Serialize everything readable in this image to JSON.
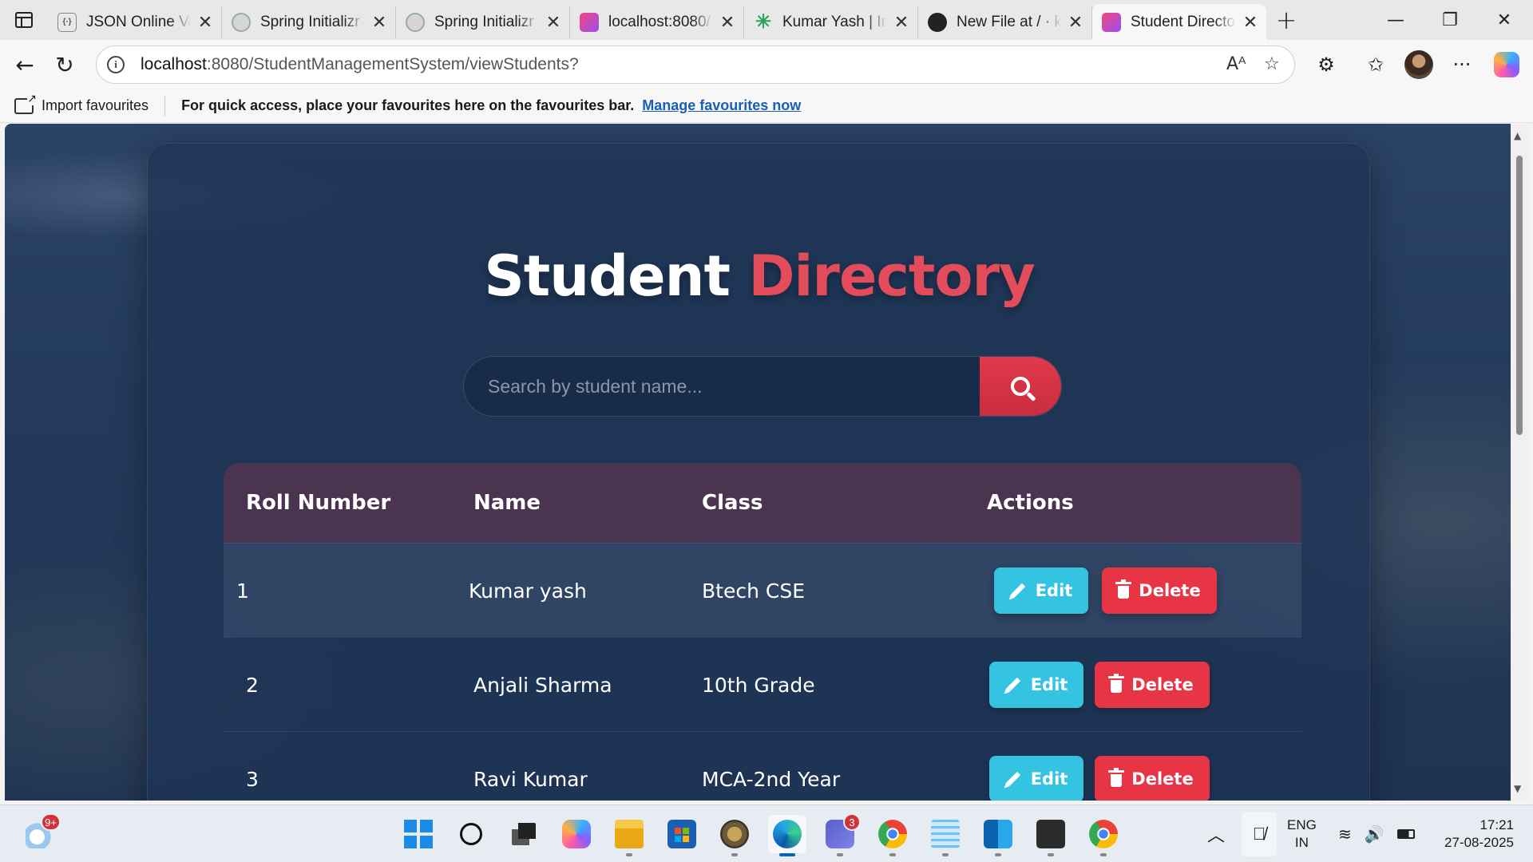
{
  "browser": {
    "tabs": [
      {
        "title": "JSON Online Va",
        "icon": "json-icon",
        "active": false
      },
      {
        "title": "Spring Initializr",
        "icon": "spring-icon",
        "active": false
      },
      {
        "title": "Spring Initializr",
        "icon": "spring-icon",
        "active": false
      },
      {
        "title": "localhost:8080/",
        "icon": "page-icon",
        "active": false
      },
      {
        "title": "Kumar Yash | Ins",
        "icon": "asterisk-icon",
        "active": false
      },
      {
        "title": "New File at / · k",
        "icon": "github-icon",
        "active": false
      },
      {
        "title": "Student Directo",
        "icon": "page-icon",
        "active": true
      }
    ],
    "url_host": "localhost",
    "url_rest": ":8080/StudentManagementSystem/viewStudents?",
    "favourites_bar": {
      "import_label": "Import favourites",
      "message": "For quick access, place your favourites here on the favourites bar.",
      "manage_link": "Manage favourites now"
    }
  },
  "page": {
    "title_main": "Student",
    "title_accent": "Directory",
    "search": {
      "placeholder": "Search by student name..."
    },
    "table": {
      "headers": [
        "Roll Number",
        "Name",
        "Class",
        "Actions"
      ],
      "rows": [
        {
          "roll": "1",
          "name": "Kumar yash",
          "class": "Btech CSE"
        },
        {
          "roll": "2",
          "name": "Anjali Sharma",
          "class": "10th Grade"
        },
        {
          "roll": "3",
          "name": "Ravi Kumar",
          "class": "MCA-2nd Year"
        }
      ],
      "edit_label": "Edit",
      "delete_label": "Delete"
    },
    "colors": {
      "accent": "#e34d5b",
      "edit": "#35c3e2",
      "delete": "#e83545",
      "header": "#4a3450"
    }
  },
  "taskbar": {
    "weather_badge": "9+",
    "teams_badge": "3",
    "lang_line1": "ENG",
    "lang_line2": "IN",
    "time": "17:21",
    "date": "27-08-2025"
  }
}
